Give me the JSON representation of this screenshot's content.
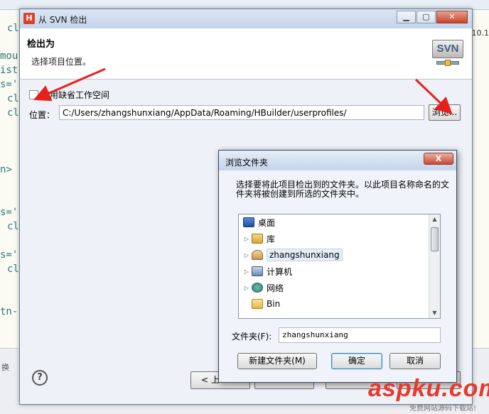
{
  "background": {
    "code_lines": [
      "cl",
      "mou",
      "ist",
      "s='",
      "cl",
      "cl",
      "n>",
      "s='",
      "cl",
      "s='",
      "cl",
      "tn-"
    ],
    "right_text": "/10.1",
    "bottom_text": "换"
  },
  "main_dialog": {
    "app_icon": "H",
    "title": "从 SVN 检出",
    "header_title": "检出为",
    "header_desc": "选择项目位置。",
    "logo_text": "SVN",
    "use_default_workspace_label": "使用缺省工作空间",
    "location_label": "位置：",
    "location_value": "C:/Users/zhangshunxiang/AppData/Roaming/HBuilder/userprofiles/",
    "browse_label": "浏览...",
    "help_label": "?",
    "back_label": "< 上一"
  },
  "folder_dialog": {
    "title": "浏览文件夹",
    "close_label": "X",
    "description": "选择要将此项目检出到的文件夹。以此项目名称命名的文件夹将被创建到所选的文件夹中。",
    "tree": [
      {
        "label": "桌面",
        "icon": "desktop-icon",
        "expandable": false
      },
      {
        "label": "库",
        "icon": "library-icon",
        "expandable": true
      },
      {
        "label": "zhangshunxiang",
        "icon": "user-folder-icon",
        "expandable": true,
        "selected": true
      },
      {
        "label": "计算机",
        "icon": "computer-icon",
        "expandable": true
      },
      {
        "label": "网络",
        "icon": "network-icon",
        "expandable": true
      },
      {
        "label": "Bin",
        "icon": "folder-icon",
        "expandable": false
      }
    ],
    "folder_label": "文件夹(F):",
    "folder_value": "zhangshunxiang",
    "new_folder_label": "新建文件夹(M)",
    "ok_label": "确定",
    "cancel_label": "取消"
  },
  "watermark": {
    "main": "aspku.com",
    "sub": "免费网站源码下载站!"
  },
  "colors": {
    "arrow": "#e8201c",
    "dialog_bg": "#eef2f8",
    "header_bg": "#ffffff"
  }
}
